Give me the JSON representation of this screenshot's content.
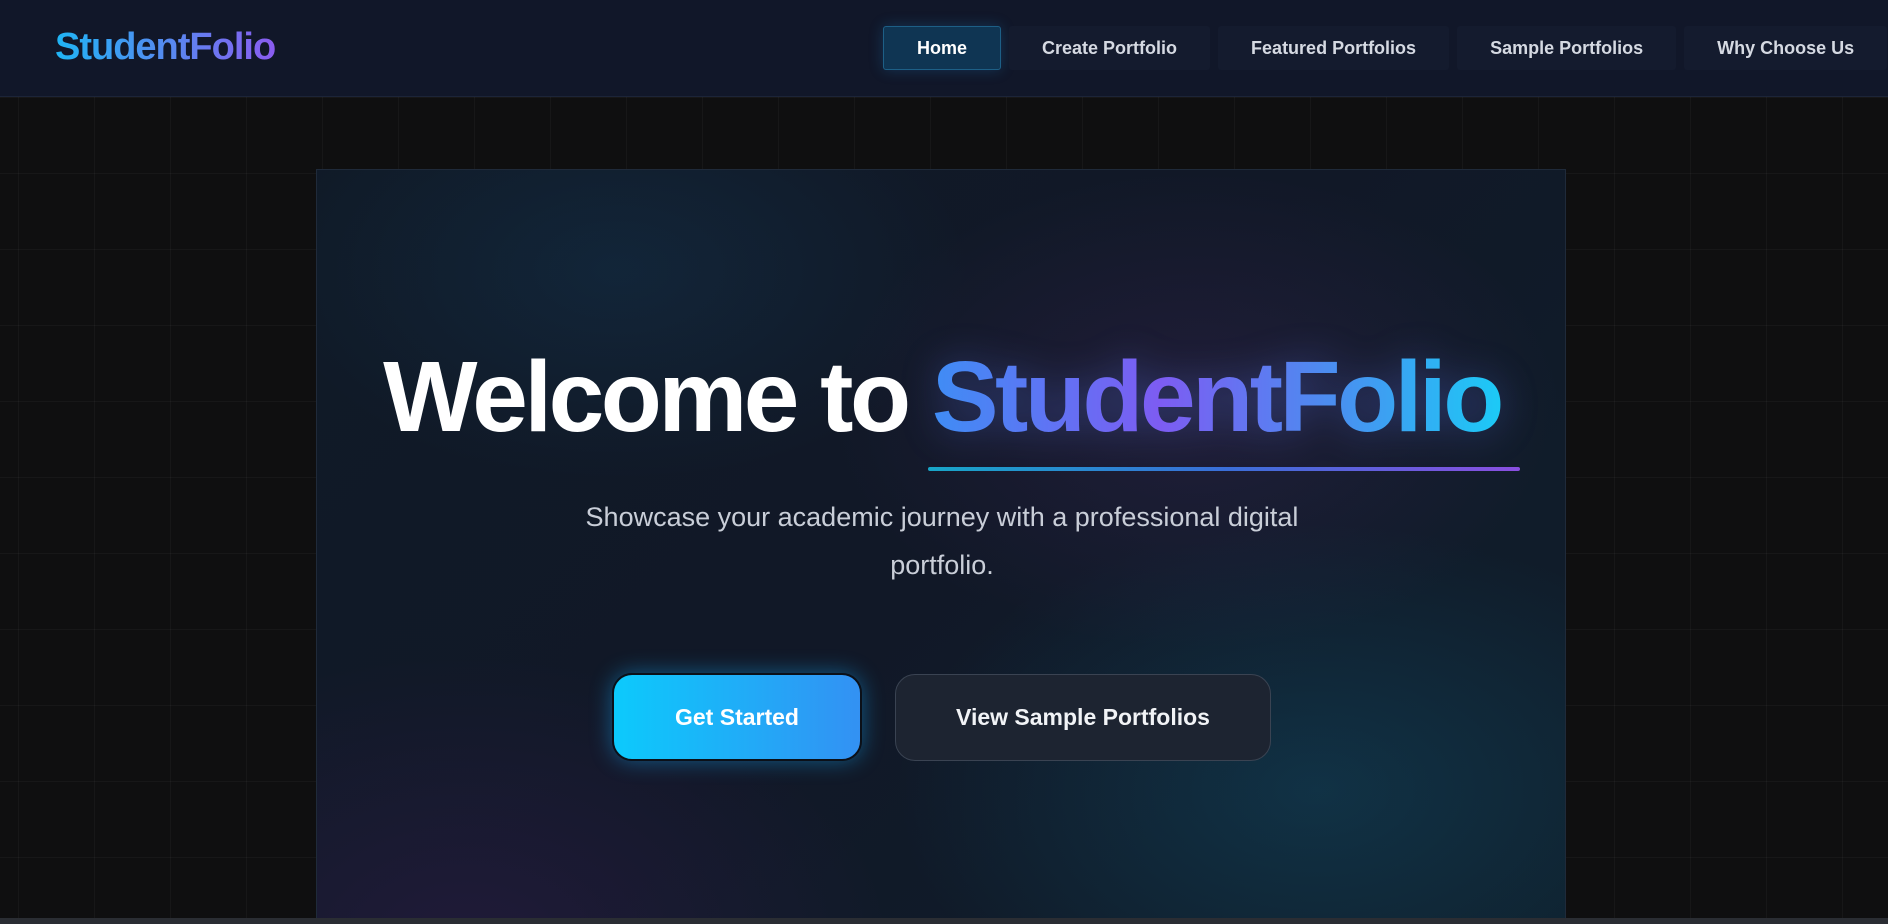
{
  "navbar": {
    "brand": "StudentFolio",
    "links": [
      {
        "label": "Home",
        "active": true
      },
      {
        "label": "Create Portfolio",
        "active": false
      },
      {
        "label": "Featured Portfolios",
        "active": false
      },
      {
        "label": "Sample Portfolios",
        "active": false
      },
      {
        "label": "Why Choose Us",
        "active": false
      }
    ]
  },
  "hero": {
    "headline_lead": "Welcome to",
    "headline_accent": "StudentFolio",
    "subtitle_line1": "Showcase your academic journey with a professional digital",
    "subtitle_line2": "portfolio.",
    "primary_button": "Get Started",
    "secondary_button": "View Sample Portfolios"
  },
  "colors": {
    "navbar_bg": "#111729",
    "page_bg": "#0f0f10",
    "accent_cyan": "#0ccafc",
    "accent_blue": "#3391f3",
    "accent_purple": "#7d5cf2",
    "active_nav_bg": "#0f3553"
  }
}
